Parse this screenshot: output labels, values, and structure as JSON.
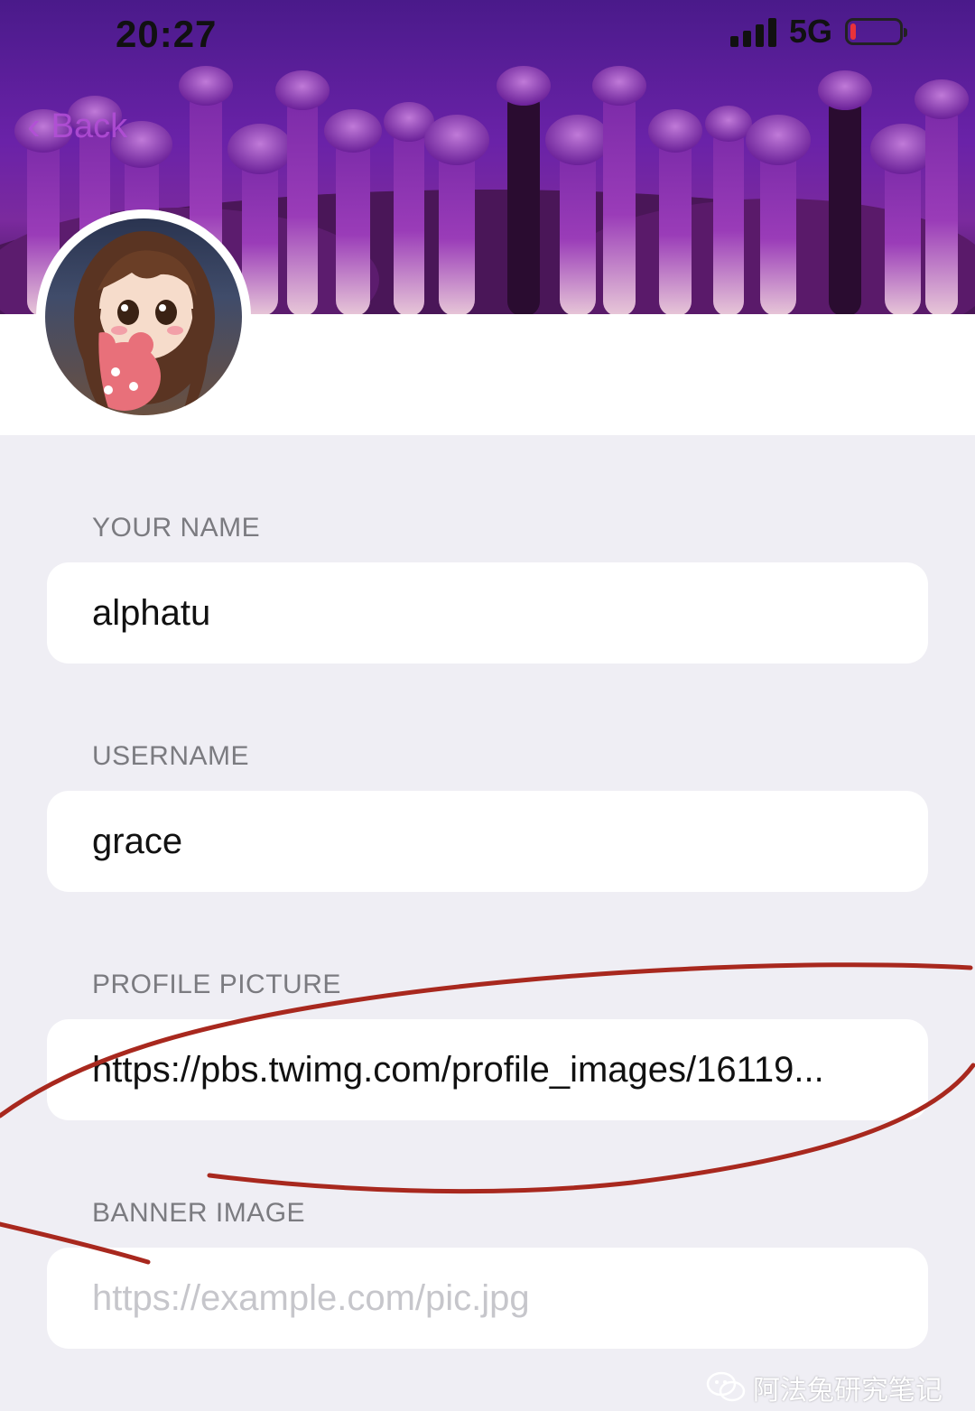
{
  "status_bar": {
    "time": "20:27",
    "network": "5G",
    "battery_level": 0.1,
    "signal_icon": "signal-bars-icon",
    "battery_icon": "battery-icon"
  },
  "nav": {
    "back_label": "Back",
    "back_icon": "chevron-left-icon"
  },
  "banner": {
    "description_icon": "ostrich-banner-image"
  },
  "form": {
    "name_label": "YOUR NAME",
    "name_value": "alphatu",
    "username_label": "USERNAME",
    "username_value": "grace",
    "profile_picture_label": "PROFILE PICTURE",
    "profile_picture_value": "https://pbs.twimg.com/profile_images/16119...",
    "banner_image_label": "BANNER IMAGE",
    "banner_image_placeholder": "https://example.com/pic.jpg"
  },
  "watermark": {
    "text": "阿法兔研究笔记",
    "icon": "wechat-icon"
  },
  "colors": {
    "banner_purple": "#6a22a8",
    "annotation_red": "#a8281e",
    "page_background": "#efeef4"
  }
}
